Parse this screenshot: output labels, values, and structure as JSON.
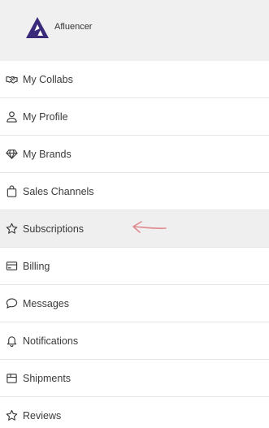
{
  "header": {
    "brand_name": "Afluencer"
  },
  "menu": {
    "items": [
      {
        "label": "My Collabs",
        "icon": "handshake-icon"
      },
      {
        "label": "My Profile",
        "icon": "user-icon"
      },
      {
        "label": "My Brands",
        "icon": "diamond-icon"
      },
      {
        "label": "Sales Channels",
        "icon": "shopping-bag-icon"
      },
      {
        "label": "Subscriptions",
        "icon": "star-icon",
        "active": true
      },
      {
        "label": "Billing",
        "icon": "credit-card-icon"
      },
      {
        "label": "Messages",
        "icon": "chat-bubble-icon"
      },
      {
        "label": "Notifications",
        "icon": "bell-icon"
      },
      {
        "label": "Shipments",
        "icon": "box-icon"
      },
      {
        "label": "Reviews",
        "icon": "star-outline-icon"
      }
    ]
  },
  "colors": {
    "header_bg": "#f0f0f0",
    "active_bg": "#efefef",
    "logo": "#3b2a7a",
    "arrow_annotation": "#e0898e"
  }
}
